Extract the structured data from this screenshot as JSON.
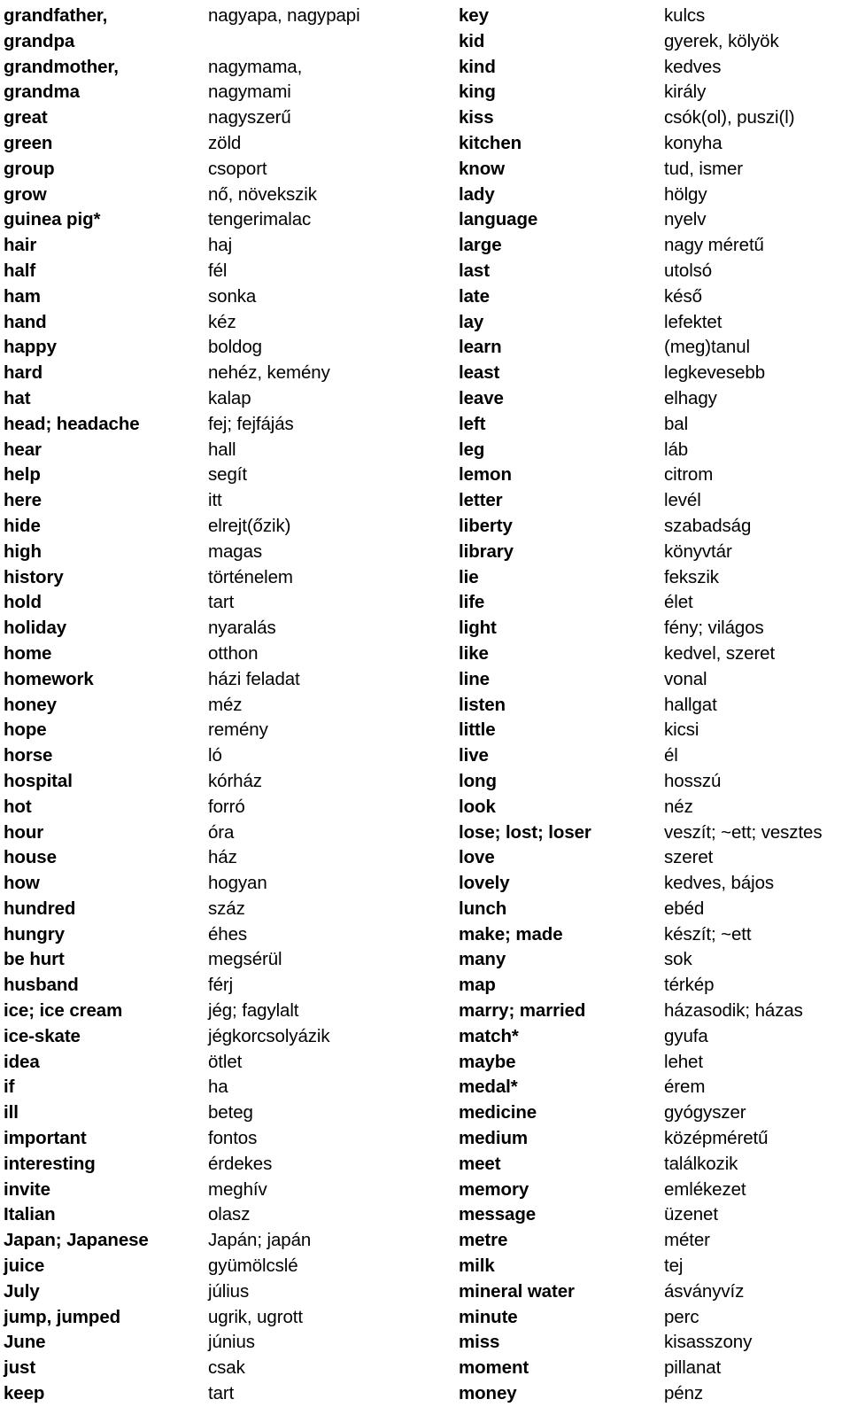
{
  "document": {
    "kind": "bilingual-wordlist",
    "source_language": "English",
    "target_language": "Hungarian",
    "layout": "two-column",
    "columns": [
      {
        "name": "left-column",
        "entries": [
          {
            "term": "grandfather,",
            "gloss": "nagyapa, nagypapi"
          },
          {
            "term": "grandpa",
            "gloss": ""
          },
          {
            "term": "grandmother,",
            "gloss": "nagymama,"
          },
          {
            "term": "grandma",
            "gloss": "nagymami"
          },
          {
            "term": "great",
            "gloss": "nagyszerű"
          },
          {
            "term": "green",
            "gloss": "zöld"
          },
          {
            "term": "group",
            "gloss": "csoport"
          },
          {
            "term": "grow",
            "gloss": "nő, növekszik"
          },
          {
            "term": "guinea pig*",
            "gloss": "tengerimalac"
          },
          {
            "term": "hair",
            "gloss": "haj"
          },
          {
            "term": "half",
            "gloss": "fél"
          },
          {
            "term": "ham",
            "gloss": "sonka"
          },
          {
            "term": "hand",
            "gloss": "kéz"
          },
          {
            "term": "happy",
            "gloss": "boldog"
          },
          {
            "term": "hard",
            "gloss": "nehéz, kemény"
          },
          {
            "term": "hat",
            "gloss": "kalap"
          },
          {
            "term": "head; headache",
            "gloss": "fej; fejfájás"
          },
          {
            "term": "hear",
            "gloss": "hall"
          },
          {
            "term": "help",
            "gloss": "segít"
          },
          {
            "term": "here",
            "gloss": "itt"
          },
          {
            "term": "hide",
            "gloss": "elrejt(őzik)"
          },
          {
            "term": "high",
            "gloss": "magas"
          },
          {
            "term": "history",
            "gloss": "történelem"
          },
          {
            "term": "hold",
            "gloss": "tart"
          },
          {
            "term": "holiday",
            "gloss": "nyaralás"
          },
          {
            "term": "home",
            "gloss": "otthon"
          },
          {
            "term": "homework",
            "gloss": "házi feladat"
          },
          {
            "term": "honey",
            "gloss": "méz"
          },
          {
            "term": "hope",
            "gloss": "remény"
          },
          {
            "term": "horse",
            "gloss": "ló"
          },
          {
            "term": "hospital",
            "gloss": "kórház"
          },
          {
            "term": "hot",
            "gloss": "forró"
          },
          {
            "term": "hour",
            "gloss": "óra"
          },
          {
            "term": "house",
            "gloss": "ház"
          },
          {
            "term": "how",
            "gloss": "hogyan"
          },
          {
            "term": "hundred",
            "gloss": "száz"
          },
          {
            "term": "hungry",
            "gloss": "éhes"
          },
          {
            "term": "be hurt",
            "gloss": "megsérül"
          },
          {
            "term": "husband",
            "gloss": "férj"
          },
          {
            "term": "ice; ice cream",
            "gloss": "jég; fagylalt"
          },
          {
            "term": "ice-skate",
            "gloss": "jégkorcsolyázik"
          },
          {
            "term": "idea",
            "gloss": "ötlet"
          },
          {
            "term": "if",
            "gloss": "ha"
          },
          {
            "term": "ill",
            "gloss": "beteg"
          },
          {
            "term": "important",
            "gloss": "fontos"
          },
          {
            "term": "interesting",
            "gloss": "érdekes"
          },
          {
            "term": "invite",
            "gloss": "meghív"
          },
          {
            "term": "Italian",
            "gloss": "olasz"
          },
          {
            "term": "Japan; Japanese",
            "gloss": "Japán; japán"
          },
          {
            "term": "juice",
            "gloss": "gyümölcslé"
          },
          {
            "term": "July",
            "gloss": "július"
          },
          {
            "term": "jump, jumped",
            "gloss": "ugrik, ugrott"
          },
          {
            "term": "June",
            "gloss": "június"
          },
          {
            "term": "just",
            "gloss": "csak"
          },
          {
            "term": "keep",
            "gloss": "tart"
          }
        ]
      },
      {
        "name": "right-column",
        "entries": [
          {
            "term": "key",
            "gloss": "kulcs"
          },
          {
            "term": "kid",
            "gloss": "gyerek, kölyök"
          },
          {
            "term": "kind",
            "gloss": "kedves"
          },
          {
            "term": "king",
            "gloss": "király"
          },
          {
            "term": "kiss",
            "gloss": "csók(ol), puszi(l)"
          },
          {
            "term": "kitchen",
            "gloss": "konyha"
          },
          {
            "term": "know",
            "gloss": "tud, ismer"
          },
          {
            "term": "lady",
            "gloss": "hölgy"
          },
          {
            "term": "language",
            "gloss": "nyelv"
          },
          {
            "term": "large",
            "gloss": "nagy méretű"
          },
          {
            "term": "last",
            "gloss": "utolsó"
          },
          {
            "term": "late",
            "gloss": "késő"
          },
          {
            "term": "lay",
            "gloss": "lefektet"
          },
          {
            "term": "learn",
            "gloss": "(meg)tanul"
          },
          {
            "term": "least",
            "gloss": "legkevesebb"
          },
          {
            "term": "leave",
            "gloss": "elhagy"
          },
          {
            "term": "left",
            "gloss": "bal"
          },
          {
            "term": "leg",
            "gloss": "láb"
          },
          {
            "term": "lemon",
            "gloss": "citrom"
          },
          {
            "term": "letter",
            "gloss": "levél"
          },
          {
            "term": "liberty",
            "gloss": "szabadság"
          },
          {
            "term": "library",
            "gloss": "könyvtár"
          },
          {
            "term": "lie",
            "gloss": "fekszik"
          },
          {
            "term": "life",
            "gloss": "élet"
          },
          {
            "term": "light",
            "gloss": "fény; világos"
          },
          {
            "term": "like",
            "gloss": "kedvel, szeret"
          },
          {
            "term": "line",
            "gloss": "vonal"
          },
          {
            "term": "listen",
            "gloss": "hallgat"
          },
          {
            "term": "little",
            "gloss": "kicsi"
          },
          {
            "term": "live",
            "gloss": "él"
          },
          {
            "term": "long",
            "gloss": "hosszú"
          },
          {
            "term": "look",
            "gloss": "néz"
          },
          {
            "term": "lose; lost; loser",
            "gloss": "veszít; ~ett; vesztes"
          },
          {
            "term": "love",
            "gloss": "szeret"
          },
          {
            "term": "lovely",
            "gloss": "kedves, bájos"
          },
          {
            "term": "lunch",
            "gloss": "ebéd"
          },
          {
            "term": "make; made",
            "gloss": "készít; ~ett"
          },
          {
            "term": "many",
            "gloss": "sok"
          },
          {
            "term": "map",
            "gloss": "térkép"
          },
          {
            "term": "marry; married",
            "gloss": "házasodik; házas"
          },
          {
            "term": "match*",
            "gloss": "gyufa"
          },
          {
            "term": "maybe",
            "gloss": "lehet"
          },
          {
            "term": "medal*",
            "gloss": "érem"
          },
          {
            "term": "medicine",
            "gloss": "gyógyszer"
          },
          {
            "term": "medium",
            "gloss": "középméretű"
          },
          {
            "term": "meet",
            "gloss": "találkozik"
          },
          {
            "term": "memory",
            "gloss": "emlékezet"
          },
          {
            "term": "message",
            "gloss": "üzenet"
          },
          {
            "term": "metre",
            "gloss": "méter"
          },
          {
            "term": "milk",
            "gloss": "tej"
          },
          {
            "term": "mineral water",
            "gloss": "ásványvíz"
          },
          {
            "term": "minute",
            "gloss": "perc"
          },
          {
            "term": "miss",
            "gloss": "kisasszony"
          },
          {
            "term": "moment",
            "gloss": "pillanat"
          },
          {
            "term": "money",
            "gloss": "pénz"
          }
        ]
      }
    ]
  }
}
